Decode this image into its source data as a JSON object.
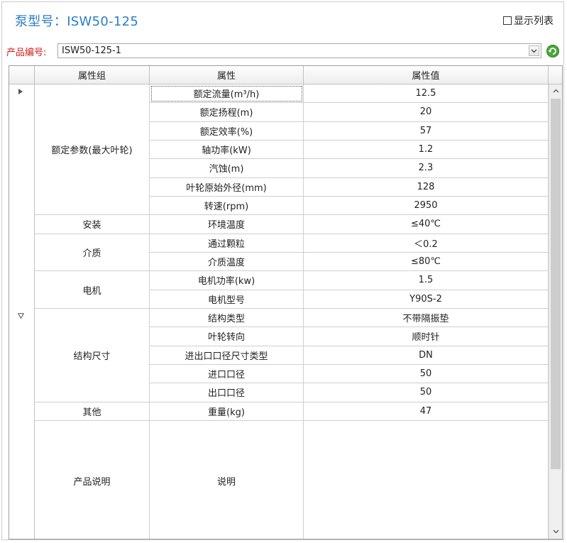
{
  "header": {
    "title": "泵型号：ISW50-125",
    "show_list_label": "显示列表"
  },
  "product": {
    "label": "产品编号:",
    "value": "ISW50-125-1"
  },
  "grid": {
    "columns": [
      "属性组",
      "属性",
      "属性值"
    ],
    "groups": [
      {
        "name": "额定参数(最大叶轮)",
        "rows": 7
      },
      {
        "name": "安装",
        "rows": 1
      },
      {
        "name": "介质",
        "rows": 2
      },
      {
        "name": "电机",
        "rows": 2
      },
      {
        "name": "结构尺寸",
        "rows": 5
      },
      {
        "name": "其他",
        "rows": 1
      },
      {
        "name": "产品说明",
        "rows": 1
      }
    ],
    "rows": [
      {
        "attr": "额定流量(m³/h)",
        "value": "12.5"
      },
      {
        "attr": "额定扬程(m)",
        "value": "20"
      },
      {
        "attr": "额定效率(%)",
        "value": "57"
      },
      {
        "attr": "轴功率(kW)",
        "value": "1.2"
      },
      {
        "attr": "汽蚀(m)",
        "value": "2.3"
      },
      {
        "attr": "叶轮原始外径(mm)",
        "value": "128"
      },
      {
        "attr": "转速(rpm)",
        "value": "2950"
      },
      {
        "attr": "环境温度",
        "value": "≤40℃"
      },
      {
        "attr": "通过颗粒",
        "value": "＜0.2"
      },
      {
        "attr": "介质温度",
        "value": "≤80℃"
      },
      {
        "attr": "电机功率(kw)",
        "value": "1.5"
      },
      {
        "attr": "电机型号",
        "value": "Y90S-2"
      },
      {
        "attr": "结构类型",
        "value": "不带隔振垫"
      },
      {
        "attr": "叶轮转向",
        "value": "顺时针"
      },
      {
        "attr": "进出口口径尺寸类型",
        "value": "DN"
      },
      {
        "attr": "进口口径",
        "value": "50"
      },
      {
        "attr": "出口口径",
        "value": "50"
      },
      {
        "attr": "重量(kg)",
        "value": "47"
      },
      {
        "attr": "说明",
        "value": ""
      }
    ]
  },
  "icons": {
    "current_row_marker": "triangle-right-icon",
    "group_marker": "triangle-down-outline-icon",
    "refresh": "refresh-icon",
    "dropdown": "chevron-down-icon"
  },
  "colors": {
    "title": "#2a7ec8",
    "label_red": "#d01c1c",
    "refresh_green": "#3a9a2e"
  }
}
